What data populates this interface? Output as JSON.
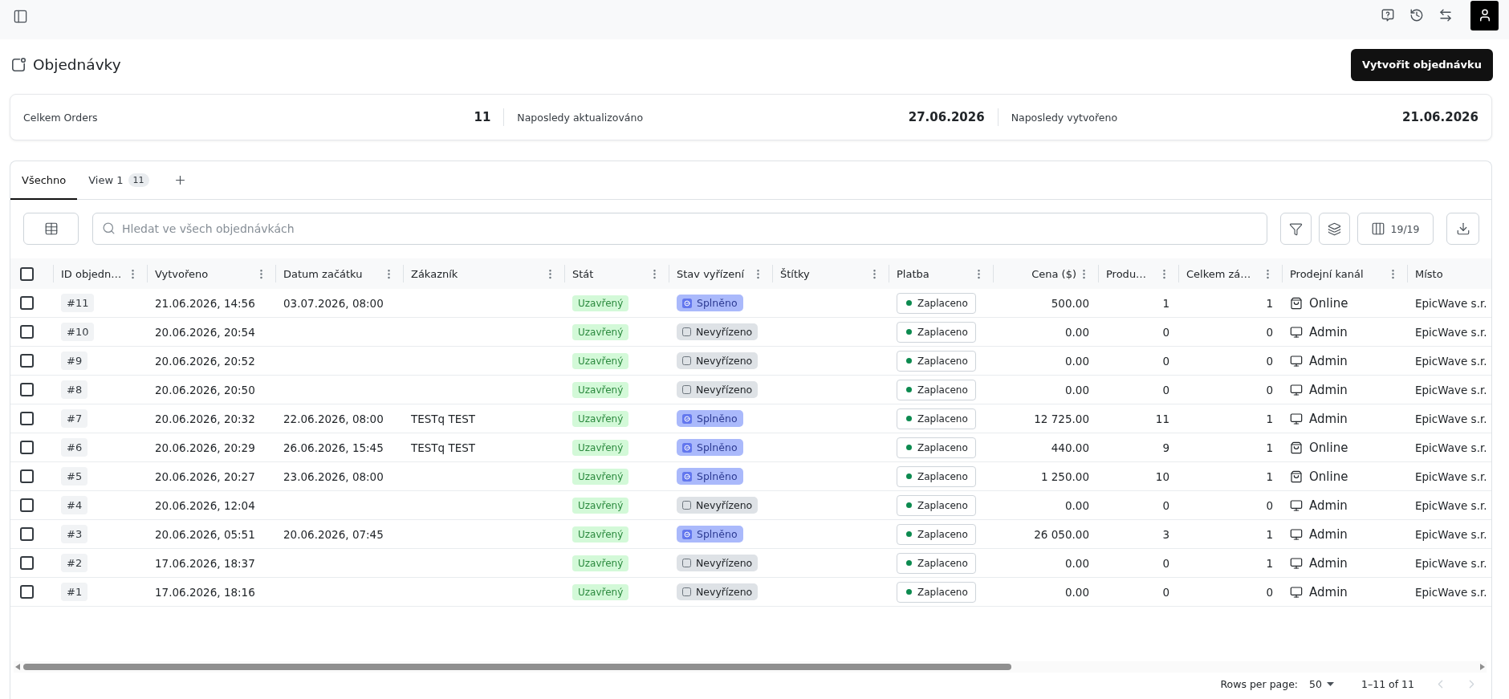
{
  "page": {
    "title": "Objednávky",
    "create_button": "Vytvořit objednávku"
  },
  "stats": [
    {
      "label": "Celkem Orders",
      "value": "11"
    },
    {
      "label": "Naposledy aktualizováno",
      "value": "27.06.2026"
    },
    {
      "label": "Naposledy vytvořeno",
      "value": "21.06.2026"
    }
  ],
  "tabs": [
    {
      "label": "Všechno",
      "selected": true
    },
    {
      "label": "View 1",
      "count": "11",
      "selected": false
    }
  ],
  "search": {
    "placeholder": "Hledat ve všech objednávkách"
  },
  "columns_button": {
    "label": "19/19"
  },
  "table": {
    "all_selected": false,
    "columns": [
      "ID objedn…",
      "Vytvořeno",
      "Datum začátku",
      "Zákazník",
      "Stát",
      "Stav vyřízení",
      "Štítky",
      "Platba",
      "Cena ($)",
      "Produ…",
      "Celkem zá…",
      "Prodejní kanál",
      "Místo"
    ],
    "rows": [
      {
        "selected": false,
        "id": "#11",
        "created": "21.06.2026, 14:56",
        "start": "03.07.2026, 08:00",
        "state": "Uzavřený",
        "fulfillment": {
          "kind": "fulfilled",
          "label": "Splněno"
        },
        "payment": "Zaplaceno",
        "price": "500.00",
        "products": "1",
        "total": "1",
        "channel": {
          "kind": "online",
          "label": "Online"
        },
        "location": "EpicWave s.r."
      },
      {
        "selected": false,
        "id": "#10",
        "created": "20.06.2026, 20:54",
        "state": "Uzavřený",
        "fulfillment": {
          "kind": "unfulfilled",
          "label": "Nevyřízeno"
        },
        "payment": "Zaplaceno",
        "price": "0.00",
        "products": "0",
        "total": "0",
        "channel": {
          "kind": "admin",
          "label": "Admin"
        },
        "location": "EpicWave s.r."
      },
      {
        "selected": false,
        "id": "#9",
        "created": "20.06.2026, 20:52",
        "state": "Uzavřený",
        "fulfillment": {
          "kind": "unfulfilled",
          "label": "Nevyřízeno"
        },
        "payment": "Zaplaceno",
        "price": "0.00",
        "products": "0",
        "total": "0",
        "channel": {
          "kind": "admin",
          "label": "Admin"
        },
        "location": "EpicWave s.r."
      },
      {
        "selected": false,
        "id": "#8",
        "created": "20.06.2026, 20:50",
        "state": "Uzavřený",
        "fulfillment": {
          "kind": "unfulfilled",
          "label": "Nevyřízeno"
        },
        "payment": "Zaplaceno",
        "price": "0.00",
        "products": "0",
        "total": "0",
        "channel": {
          "kind": "admin",
          "label": "Admin"
        },
        "location": "EpicWave s.r."
      },
      {
        "selected": false,
        "id": "#7",
        "created": "20.06.2026, 20:32",
        "start": "22.06.2026, 08:00",
        "customer": "TESTq TEST",
        "state": "Uzavřený",
        "fulfillment": {
          "kind": "fulfilled",
          "label": "Splněno"
        },
        "payment": "Zaplaceno",
        "price": "12 725.00",
        "products": "11",
        "total": "1",
        "channel": {
          "kind": "admin",
          "label": "Admin"
        },
        "location": "EpicWave s.r."
      },
      {
        "selected": false,
        "id": "#6",
        "created": "20.06.2026, 20:29",
        "start": "26.06.2026, 15:45",
        "customer": "TESTq TEST",
        "state": "Uzavřený",
        "fulfillment": {
          "kind": "fulfilled",
          "label": "Splněno"
        },
        "payment": "Zaplaceno",
        "price": "440.00",
        "products": "9",
        "total": "1",
        "channel": {
          "kind": "online",
          "label": "Online"
        },
        "location": "EpicWave s.r."
      },
      {
        "selected": false,
        "id": "#5",
        "created": "20.06.2026, 20:27",
        "start": "23.06.2026, 08:00",
        "state": "Uzavřený",
        "fulfillment": {
          "kind": "fulfilled",
          "label": "Splněno"
        },
        "payment": "Zaplaceno",
        "price": "1 250.00",
        "products": "10",
        "total": "1",
        "channel": {
          "kind": "online",
          "label": "Online"
        },
        "location": "EpicWave s.r."
      },
      {
        "selected": false,
        "id": "#4",
        "created": "20.06.2026, 12:04",
        "state": "Uzavřený",
        "fulfillment": {
          "kind": "unfulfilled",
          "label": "Nevyřízeno"
        },
        "payment": "Zaplaceno",
        "price": "0.00",
        "products": "0",
        "total": "0",
        "channel": {
          "kind": "admin",
          "label": "Admin"
        },
        "location": "EpicWave s.r."
      },
      {
        "selected": false,
        "id": "#3",
        "created": "20.06.2026, 05:51",
        "start": "20.06.2026, 07:45",
        "state": "Uzavřený",
        "fulfillment": {
          "kind": "fulfilled",
          "label": "Splněno"
        },
        "payment": "Zaplaceno",
        "price": "26 050.00",
        "products": "3",
        "total": "1",
        "channel": {
          "kind": "admin",
          "label": "Admin"
        },
        "location": "EpicWave s.r."
      },
      {
        "selected": false,
        "id": "#2",
        "created": "17.06.2026, 18:37",
        "state": "Uzavřený",
        "fulfillment": {
          "kind": "unfulfilled",
          "label": "Nevyřízeno"
        },
        "payment": "Zaplaceno",
        "price": "0.00",
        "products": "0",
        "total": "1",
        "channel": {
          "kind": "admin",
          "label": "Admin"
        },
        "location": "EpicWave s.r."
      },
      {
        "selected": false,
        "id": "#1",
        "created": "17.06.2026, 18:16",
        "state": "Uzavřený",
        "fulfillment": {
          "kind": "unfulfilled",
          "label": "Nevyřízeno"
        },
        "payment": "Zaplaceno",
        "price": "0.00",
        "products": "0",
        "total": "0",
        "channel": {
          "kind": "admin",
          "label": "Admin"
        },
        "location": "EpicWave s.r."
      }
    ]
  },
  "pagination": {
    "rows_per_page_label": "Rows per page:",
    "rows_per_page": "50",
    "range": "1–11 of 11",
    "previous_disabled": true,
    "next_disabled": true
  }
}
